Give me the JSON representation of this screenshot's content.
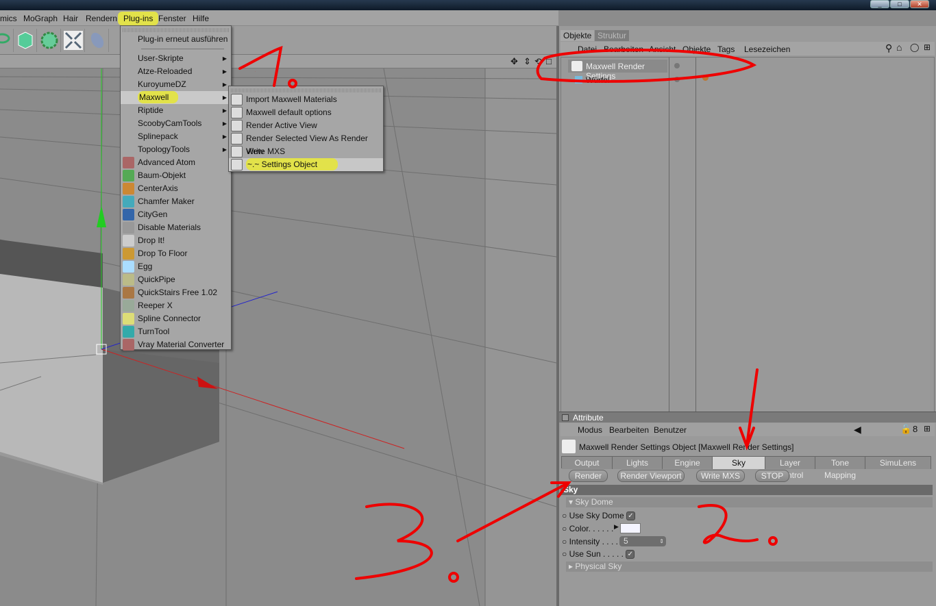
{
  "window": {
    "buttons": [
      "_",
      "□",
      "✕"
    ]
  },
  "menubar": [
    "mics",
    "MoGraph",
    "Hair",
    "Rendern",
    "Plug-ins",
    "Fenster",
    "Hilfe"
  ],
  "plugins_menu": {
    "rerun": "Plug-in erneut ausführen",
    "items": [
      {
        "label": "User-Skripte",
        "sub": true
      },
      {
        "label": "Atze-Reloaded",
        "sub": true
      },
      {
        "label": "KuroyumeDZ",
        "sub": true
      },
      {
        "label": "Maxwell",
        "sub": true
      },
      {
        "label": "Riptide",
        "sub": true
      },
      {
        "label": "ScoobyCamTools",
        "sub": true
      },
      {
        "label": "Splinepack",
        "sub": true
      },
      {
        "label": "TopologyTools",
        "sub": true
      },
      {
        "label": "Advanced Atom"
      },
      {
        "label": "Baum-Objekt"
      },
      {
        "label": "CenterAxis"
      },
      {
        "label": "Chamfer Maker"
      },
      {
        "label": "CityGen"
      },
      {
        "label": "Disable Materials"
      },
      {
        "label": "Drop It!"
      },
      {
        "label": "Drop To Floor"
      },
      {
        "label": "Egg"
      },
      {
        "label": "QuickPipe"
      },
      {
        "label": "QuickStairs Free 1.02"
      },
      {
        "label": "Reeper X"
      },
      {
        "label": "Spline Connector"
      },
      {
        "label": "TurnTool"
      },
      {
        "label": "Vray Material Converter"
      }
    ]
  },
  "maxwell_menu": [
    "Import Maxwell Materials",
    "Maxwell default options",
    "Render Active View",
    "Render Selected View As Render View",
    "Write MXS",
    "~.~ Settings Object"
  ],
  "objects": {
    "tabs": [
      "Objekte",
      "Struktur"
    ],
    "menu": [
      "Datei",
      "Bearbeiten",
      "Ansicht",
      "Objekte",
      "Tags",
      "Lesezeichen"
    ],
    "items": [
      "Maxwell Render Settings",
      "Würfel"
    ]
  },
  "attribute": {
    "title": "Attribute",
    "menu": [
      "Modus",
      "Bearbeiten",
      "Benutzer"
    ],
    "object_title": "Maxwell Render Settings Object [Maxwell Render Settings]",
    "tabs": [
      "Output",
      "Lights",
      "Engine",
      "Sky",
      "Layer Control",
      "Tone Mapping",
      "SimuLens"
    ],
    "active_tab": "Sky",
    "buttons": [
      "Render",
      "Render Viewport",
      "Write MXS",
      "STOP"
    ],
    "section": "Sky",
    "group": "Sky Dome",
    "props": {
      "use_sky_dome": "Use Sky Dome",
      "color": "Color. . . . . .",
      "intensity": "Intensity . . . . .",
      "intensity_value": "5",
      "use_sun": "Use Sun . . . . ."
    },
    "color_value": "#f4f4ff",
    "subgroup": "Physical Sky"
  },
  "annotations": {
    "step1": "1.",
    "step2": "2.",
    "step3": "3."
  }
}
